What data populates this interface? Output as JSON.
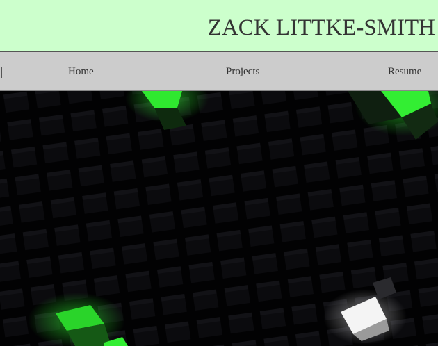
{
  "header": {
    "title": "ZACK LITTKE-SMITH"
  },
  "nav": {
    "items": [
      {
        "label": "Home"
      },
      {
        "label": "Projects"
      },
      {
        "label": "Resume"
      }
    ]
  },
  "colors": {
    "header_bg": "#ccffcc",
    "nav_bg": "#cccccc",
    "hero_bg": "#000000",
    "accent_green": "#33ee33"
  }
}
